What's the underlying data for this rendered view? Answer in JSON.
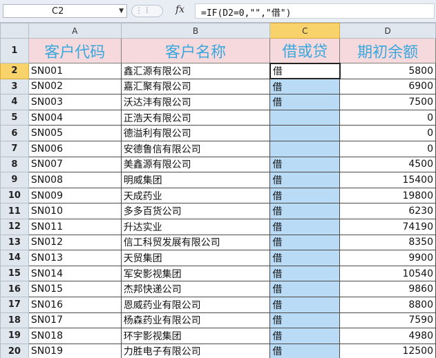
{
  "formula_bar": {
    "name_box": "C2",
    "formula": "=IF(D2=0,\"\",\"借\")"
  },
  "columns": [
    "A",
    "B",
    "C",
    "D"
  ],
  "header_row": {
    "row_num": "1",
    "cells": [
      "客户代码",
      "客户名称",
      "借或贷",
      "期初余额"
    ]
  },
  "rows": [
    {
      "n": "2",
      "code": "SN001",
      "name": "鑫汇源有限公司",
      "flag": "借",
      "balance": "5800"
    },
    {
      "n": "3",
      "code": "SN002",
      "name": "嘉汇聚有限公司",
      "flag": "借",
      "balance": "6900"
    },
    {
      "n": "4",
      "code": "SN003",
      "name": "沃达沣有限公司",
      "flag": "借",
      "balance": "7500"
    },
    {
      "n": "5",
      "code": "SN004",
      "name": "正浩天有限公司",
      "flag": "",
      "balance": "0"
    },
    {
      "n": "6",
      "code": "SN005",
      "name": "德溢利有限公司",
      "flag": "",
      "balance": "0"
    },
    {
      "n": "7",
      "code": "SN006",
      "name": "安德鲁信有限公司",
      "flag": "",
      "balance": "0"
    },
    {
      "n": "8",
      "code": "SN007",
      "name": "美鑫源有限公司",
      "flag": "借",
      "balance": "4500"
    },
    {
      "n": "9",
      "code": "SN008",
      "name": "明威集团",
      "flag": "借",
      "balance": "15400"
    },
    {
      "n": "10",
      "code": "SN009",
      "name": "天成药业",
      "flag": "借",
      "balance": "19800"
    },
    {
      "n": "11",
      "code": "SN010",
      "name": "多多百货公司",
      "flag": "借",
      "balance": "6230"
    },
    {
      "n": "12",
      "code": "SN011",
      "name": "升达实业",
      "flag": "借",
      "balance": "74190"
    },
    {
      "n": "13",
      "code": "SN012",
      "name": "信工科贸发展有限公司",
      "flag": "借",
      "balance": "8350"
    },
    {
      "n": "14",
      "code": "SN013",
      "name": "天贸集团",
      "flag": "借",
      "balance": "9900"
    },
    {
      "n": "15",
      "code": "SN014",
      "name": "军安影视集团",
      "flag": "借",
      "balance": "10540"
    },
    {
      "n": "16",
      "code": "SN015",
      "name": "杰邦快递公司",
      "flag": "借",
      "balance": "9860"
    },
    {
      "n": "17",
      "code": "SN016",
      "name": "恩威药业有限公司",
      "flag": "借",
      "balance": "8800"
    },
    {
      "n": "18",
      "code": "SN017",
      "name": "杨森药业有限公司",
      "flag": "借",
      "balance": "7590"
    },
    {
      "n": "19",
      "code": "SN018",
      "name": "环宇影视集团",
      "flag": "借",
      "balance": "4980"
    },
    {
      "n": "20",
      "code": "SN019",
      "name": "力胜电子有限公司",
      "flag": "借",
      "balance": "12500"
    }
  ]
}
